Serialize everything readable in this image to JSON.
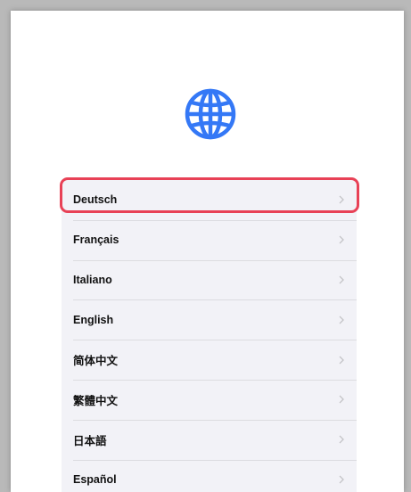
{
  "languages": [
    {
      "label": "Deutsch"
    },
    {
      "label": "Français"
    },
    {
      "label": "Italiano"
    },
    {
      "label": "English"
    },
    {
      "label": "简体中文"
    },
    {
      "label": "繁體中文"
    },
    {
      "label": "日本語"
    },
    {
      "label": "Español"
    }
  ],
  "colors": {
    "globe": "#3478f6",
    "highlight": "#e84156",
    "list_background": "#f2f2f7",
    "chevron": "#c4c4c7"
  },
  "icons": {
    "globe": "globe-icon",
    "chevron": "chevron-right-icon"
  }
}
